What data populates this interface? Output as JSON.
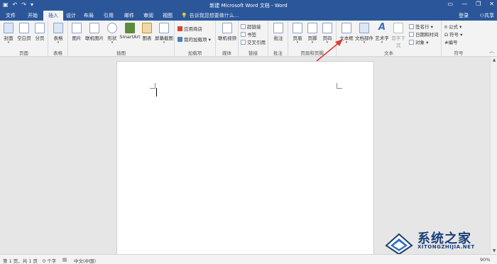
{
  "title_bar": {
    "title": "新建 Microsoft Word 文档 - Word",
    "quick_access": [
      "save-icon",
      "undo-icon",
      "redo-icon",
      "customize-icon"
    ],
    "window_buttons": [
      "ribbon-options-icon",
      "minimize-icon",
      "restore-icon",
      "close-icon"
    ]
  },
  "tabs": {
    "file": "文件",
    "items": [
      "开始",
      "插入",
      "设计",
      "布局",
      "引用",
      "邮件",
      "审阅",
      "视图"
    ],
    "active": "插入",
    "tell_me": "告诉我您想要做什么...",
    "login": "登录",
    "share": "共享"
  },
  "ribbon": {
    "pages": {
      "label": "页面",
      "cover": "封面",
      "blank": "空白页",
      "break": "分页"
    },
    "tables": {
      "label": "表格",
      "table": "表格"
    },
    "illustrations": {
      "label": "插图",
      "picture": "图片",
      "online_picture": "联机图片",
      "shapes": "形状",
      "smartart": "SmartArt",
      "chart": "图表",
      "screenshot": "屏幕截图"
    },
    "addins": {
      "label": "加载项",
      "store": "应用商店",
      "my_addins": "我的加载项"
    },
    "media": {
      "label": "媒体",
      "online_video": "联机视频"
    },
    "links": {
      "label": "链接",
      "hyperlink": "超链接",
      "bookmark": "书签",
      "cross_ref": "交叉引用"
    },
    "comments": {
      "label": "批注",
      "comment": "批注"
    },
    "header_footer": {
      "label": "页眉和页脚",
      "header": "页眉",
      "footer": "页脚",
      "page_number": "页码"
    },
    "text": {
      "label": "文本",
      "textbox": "文本框",
      "quick_parts": "文档部件",
      "wordart": "艺术字",
      "dropcap": "首字下沉",
      "signature": "签名行",
      "datetime": "日期和时间",
      "object": "对象"
    },
    "symbols": {
      "label": "符号",
      "equation": "公式",
      "symbol": "符号",
      "number": "编号"
    }
  },
  "status_bar": {
    "page": "第 1 页，共 1 页",
    "words": "0 个字",
    "language": "中文(中国)",
    "zoom": "90%"
  },
  "watermark": {
    "cn": "系统之家",
    "en": "XITONGZHIJIA.NET"
  }
}
